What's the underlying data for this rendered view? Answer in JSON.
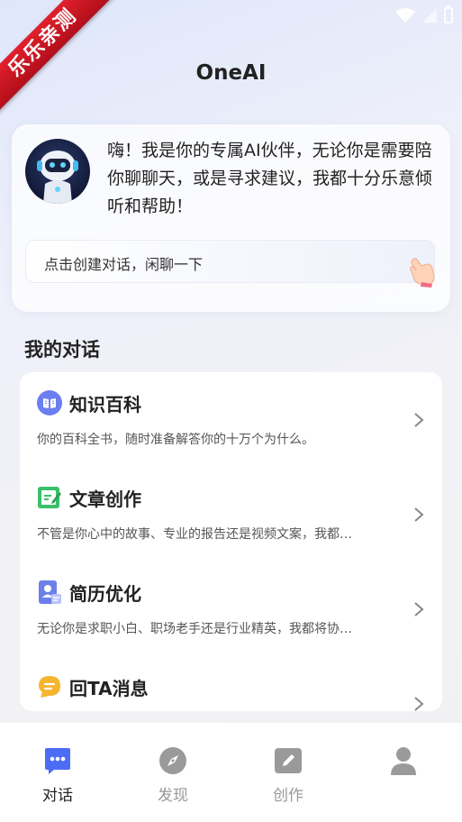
{
  "ribbon": {
    "text": "乐乐亲测"
  },
  "app": {
    "title": "OneAI"
  },
  "intro": {
    "greeting": "嗨！我是你的专属AI伙伴，无论你是需要陪你聊聊天，或是寻求建议，我都十分乐意倾听和帮助！",
    "cta_label": "点击创建对话，闲聊一下"
  },
  "section": {
    "title": "我的对话"
  },
  "conversations": [
    {
      "title": "知识百科",
      "desc": "你的百科全书，随时准备解答你的十万个为什么。",
      "icon": "book-icon"
    },
    {
      "title": "文章创作",
      "desc": "不管是你心中的故事、专业的报告还是视频文案，我都…",
      "icon": "edit-icon"
    },
    {
      "title": "简历优化",
      "desc": "无论你是求职小白、职场老手还是行业精英，我都将协…",
      "icon": "resume-icon"
    },
    {
      "title": "回TA消息",
      "desc": "",
      "icon": "message-icon"
    }
  ],
  "tabs": [
    {
      "label": "对话",
      "icon": "chat-icon",
      "active": true
    },
    {
      "label": "发现",
      "icon": "compass-icon",
      "active": false
    },
    {
      "label": "创作",
      "icon": "pencil-icon",
      "active": false
    },
    {
      "label": "",
      "icon": "profile-icon",
      "active": false
    }
  ],
  "colors": {
    "accent": "#4d6cf5",
    "muted": "#999999"
  }
}
